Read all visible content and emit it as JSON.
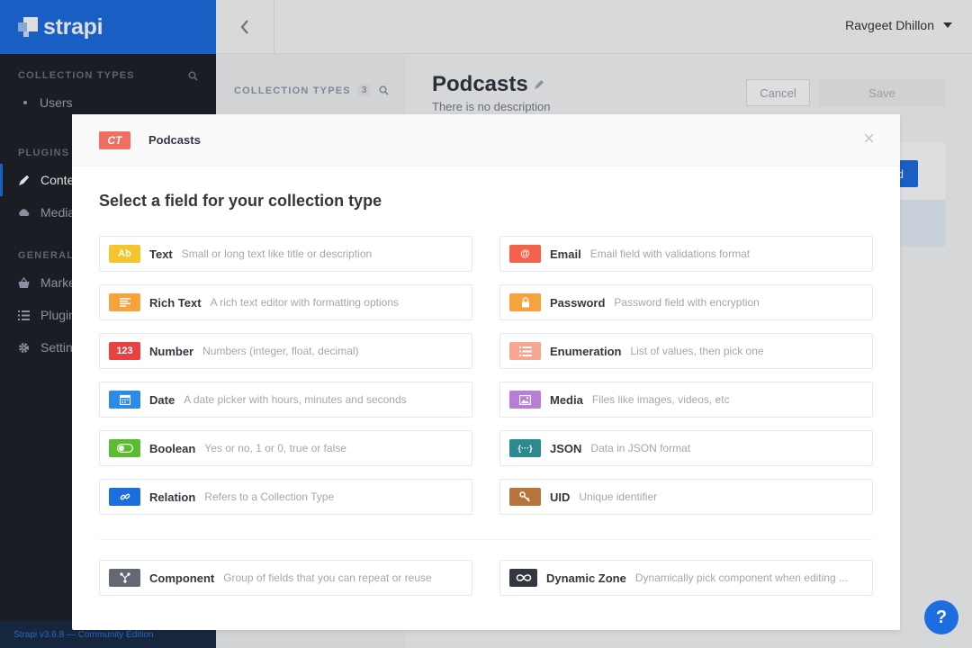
{
  "sidebar": {
    "brand": "strapi",
    "collection_types_heading": "COLLECTION TYPES",
    "collection_items": [
      {
        "label": "Users"
      }
    ],
    "plugins_heading": "PLUGINS",
    "plugin_items": [
      {
        "label": "Conte",
        "icon": "pencil-icon",
        "active": true
      },
      {
        "label": "Media",
        "icon": "cloud-icon"
      }
    ],
    "general_heading": "GENERAL",
    "general_items": [
      {
        "label": "Marke",
        "icon": "basket-icon"
      },
      {
        "label": "Plugin",
        "icon": "list-icon"
      },
      {
        "label": "Settin",
        "icon": "gear-icon"
      }
    ],
    "footer": "Strapi v3.6.8 — Community Edition"
  },
  "header": {
    "back_glyph": "‹",
    "user_name": "Ravgeet Dhillon"
  },
  "content": {
    "ct_heading": "COLLECTION TYPES",
    "ct_count": "3",
    "page_title": "Podcasts",
    "description": "There is no description",
    "cancel_label": "Cancel",
    "save_label": "Save",
    "card_button_label": "d"
  },
  "modal": {
    "badge": "CT",
    "name": "Podcasts",
    "close_glyph": "×",
    "title": "Select a field for your collection type",
    "left_fields": [
      {
        "name": "Text",
        "desc": "Small or long text like title or description",
        "icon": "text-icon",
        "icon_label": "Ab",
        "color": "#f6c52d"
      },
      {
        "name": "Rich Text",
        "desc": "A rich text editor with formatting options",
        "icon": "rich-text-icon",
        "icon_label": "",
        "color": "#f6a23d"
      },
      {
        "name": "Number",
        "desc": "Numbers (integer, float, decimal)",
        "icon": "number-icon",
        "icon_label": "123",
        "color": "#e94142"
      },
      {
        "name": "Date",
        "desc": "A date picker with hours, minutes and seconds",
        "icon": "calendar-icon",
        "icon_label": "",
        "color": "#2c8be8"
      },
      {
        "name": "Boolean",
        "desc": "Yes or no, 1 or 0, true or false",
        "icon": "toggle-icon",
        "icon_label": "",
        "color": "#5bbc2e"
      },
      {
        "name": "Relation",
        "desc": "Refers to a Collection Type",
        "icon": "link-icon",
        "icon_label": "",
        "color": "#1c6de0"
      }
    ],
    "right_fields": [
      {
        "name": "Email",
        "desc": "Email field with validations format",
        "icon": "at-icon",
        "icon_label": "@",
        "color": "#f4624c"
      },
      {
        "name": "Password",
        "desc": "Password field with encryption",
        "icon": "lock-icon",
        "icon_label": "",
        "color": "#f6a23d"
      },
      {
        "name": "Enumeration",
        "desc": "List of values, then pick one",
        "icon": "enum-list-icon",
        "icon_label": "",
        "color": "#f7a68f"
      },
      {
        "name": "Media",
        "desc": "Files like images, videos, etc",
        "icon": "image-icon",
        "icon_label": "",
        "color": "#b67ed6"
      },
      {
        "name": "JSON",
        "desc": "Data in JSON format",
        "icon": "json-icon",
        "icon_label": "{···}",
        "color": "#2a8a8e"
      },
      {
        "name": "UID",
        "desc": "Unique identifier",
        "icon": "key-icon",
        "icon_label": "",
        "color": "#b6763b"
      }
    ],
    "component_field": {
      "name": "Component",
      "desc": "Group of fields that you can repeat or reuse",
      "icon": "component-icon",
      "icon_label": "",
      "color": "#636873"
    },
    "dynamic_zone_field": {
      "name": "Dynamic Zone",
      "desc": "Dynamically pick component when editing ...",
      "icon": "infinity-icon",
      "icon_label": "",
      "color": "#333740"
    }
  },
  "help": {
    "label": "?"
  }
}
